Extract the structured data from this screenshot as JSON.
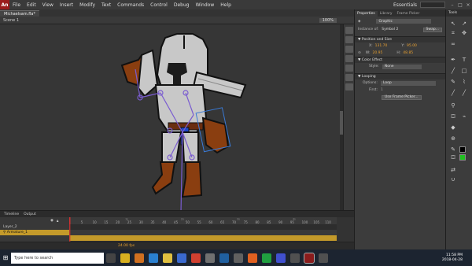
{
  "app": {
    "logo": "An",
    "essentials": "Essentials"
  },
  "menu": [
    "File",
    "Edit",
    "View",
    "Insert",
    "Modify",
    "Text",
    "Commands",
    "Control",
    "Debug",
    "Window",
    "Help"
  ],
  "document": {
    "tab": "Michaelsam.fla*",
    "scene": "Scene 1",
    "zoom": "100%"
  },
  "properties": {
    "tabs": [
      "Properties",
      "Library",
      "Frame Picker"
    ],
    "type": "Graphic",
    "instance_label": "Instance of:",
    "instance_value": "Symbol 2",
    "swap_button": "Swap...",
    "position_section": "Position and Size",
    "x_label": "X:",
    "x_value": "131.70",
    "y_label": "Y:",
    "y_value": "95.00",
    "w_label": "W:",
    "w_value": "20.95",
    "h_label": "H:",
    "h_value": "48.85",
    "color_section": "Color Effect",
    "style_label": "Style:",
    "style_value": "None",
    "looping_section": "Looping",
    "options_label": "Options:",
    "options_value": "Loop",
    "first_label": "First:",
    "first_value": "1",
    "frame_picker_button": "Use Frame Picker..."
  },
  "tools_panel": {
    "title": "Tools"
  },
  "timeline": {
    "tabs": [
      "Timeline",
      "Output"
    ],
    "layers": [
      "Layer_2",
      "Armature_1"
    ],
    "ruler": [
      "1s",
      "2s",
      "3s",
      "4s",
      "5s"
    ],
    "frame_numbers": [
      "5",
      "10",
      "15",
      "20",
      "25",
      "30",
      "35",
      "40",
      "45",
      "50",
      "55",
      "60",
      "65",
      "70",
      "75",
      "80",
      "85",
      "90",
      "95",
      "100",
      "105",
      "110"
    ],
    "fps": "24.00 fps"
  },
  "taskbar": {
    "search_placeholder": "Type here to search",
    "time": "11:58 PM",
    "date": "2018-04-28"
  },
  "colors": {
    "accent": "#e8a030",
    "bone": "#7a5cd0",
    "stage": "#363636"
  }
}
